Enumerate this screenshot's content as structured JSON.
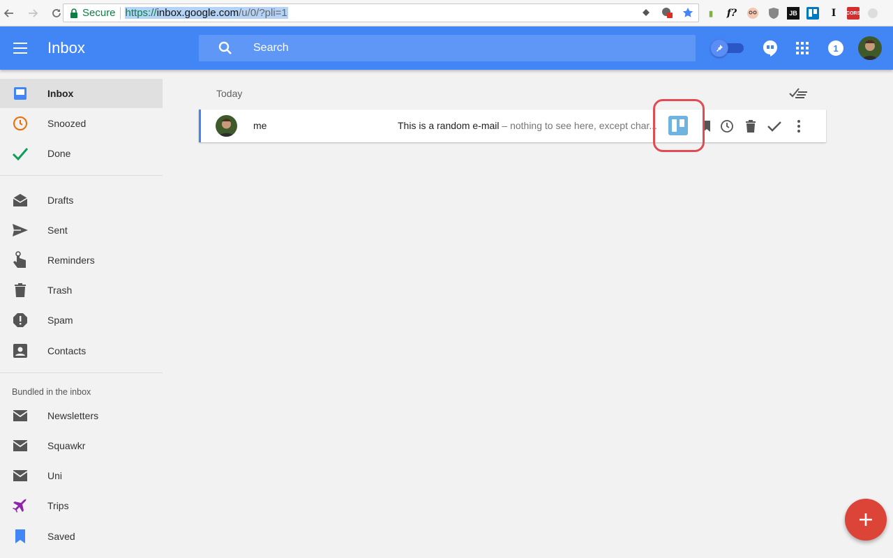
{
  "browser": {
    "secure_label": "Secure",
    "url_scheme": "https://",
    "url_host": "inbox.google.com",
    "url_path": "/u/0/?pli=1",
    "extensions": [
      "evernote-icon",
      "f?",
      "face-icon",
      "ublock-icon",
      "JB",
      "trello-icon",
      "I",
      "CORS",
      "ext-icon"
    ]
  },
  "header": {
    "title": "Inbox",
    "search_placeholder": "Search",
    "notification_count": "1",
    "accent_color": "#4285f4"
  },
  "sidebar": {
    "items": [
      {
        "label": "Inbox",
        "icon": "inbox-icon",
        "active": true
      },
      {
        "label": "Snoozed",
        "icon": "clock-icon"
      },
      {
        "label": "Done",
        "icon": "check-icon"
      },
      {
        "label": "Drafts",
        "icon": "drafts-icon"
      },
      {
        "label": "Sent",
        "icon": "send-icon"
      },
      {
        "label": "Reminders",
        "icon": "reminder-icon"
      },
      {
        "label": "Trash",
        "icon": "trash-icon"
      },
      {
        "label": "Spam",
        "icon": "spam-icon"
      },
      {
        "label": "Contacts",
        "icon": "contacts-icon"
      }
    ],
    "bundles_label": "Bundled in the inbox",
    "bundles": [
      {
        "label": "Newsletters",
        "icon": "mail-icon"
      },
      {
        "label": "Squawkr",
        "icon": "mail-icon"
      },
      {
        "label": "Uni",
        "icon": "mail-icon"
      },
      {
        "label": "Trips",
        "icon": "plane-icon"
      },
      {
        "label": "Saved",
        "icon": "bookmark-icon"
      }
    ]
  },
  "main": {
    "section_label": "Today",
    "messages": [
      {
        "sender": "me",
        "subject": "This is a random e-mail",
        "snippet": " – nothing to see here, except char..."
      }
    ]
  }
}
